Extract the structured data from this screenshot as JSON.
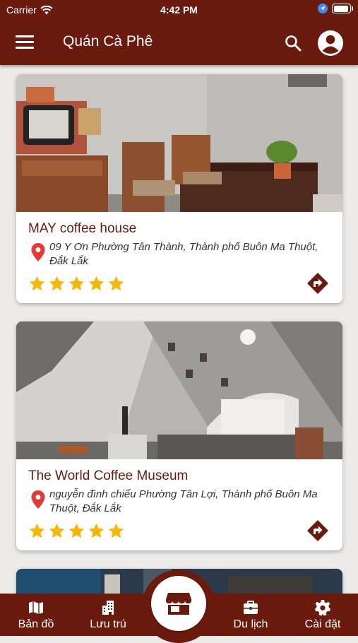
{
  "status_bar": {
    "carrier": "Carrier",
    "time": "4:42 PM"
  },
  "app_bar": {
    "title": "Quán Cà Phê",
    "icons": [
      "menu-icon",
      "search-icon",
      "account-icon"
    ]
  },
  "cafes": [
    {
      "name": "MAY coffee house",
      "address": "09 Y Ơn Phường Tân Thành, Thành phố Buôn Ma Thuột, Đắk Lắk",
      "rating": 5
    },
    {
      "name": "The World Coffee Museum",
      "address": "nguyễn đình chiểu Phường Tân Lợi, Thành phố Buôn Ma Thuột, Đắk Lắk",
      "rating": 5
    },
    {
      "name": "",
      "address": "",
      "rating": 0
    }
  ],
  "bottom_nav": {
    "items": [
      {
        "label": "Bản đồ",
        "icon": "map-icon"
      },
      {
        "label": "Lưu trú",
        "icon": "building-icon"
      },
      {
        "label": "",
        "icon": "store-icon"
      },
      {
        "label": "Du lịch",
        "icon": "briefcase-icon"
      },
      {
        "label": "Cài đặt",
        "icon": "gear-icon"
      }
    ]
  },
  "colors": {
    "primary": "#6b1a0e",
    "star": "#f5b70a",
    "pin": "#e53935",
    "background": "#ecebea"
  }
}
